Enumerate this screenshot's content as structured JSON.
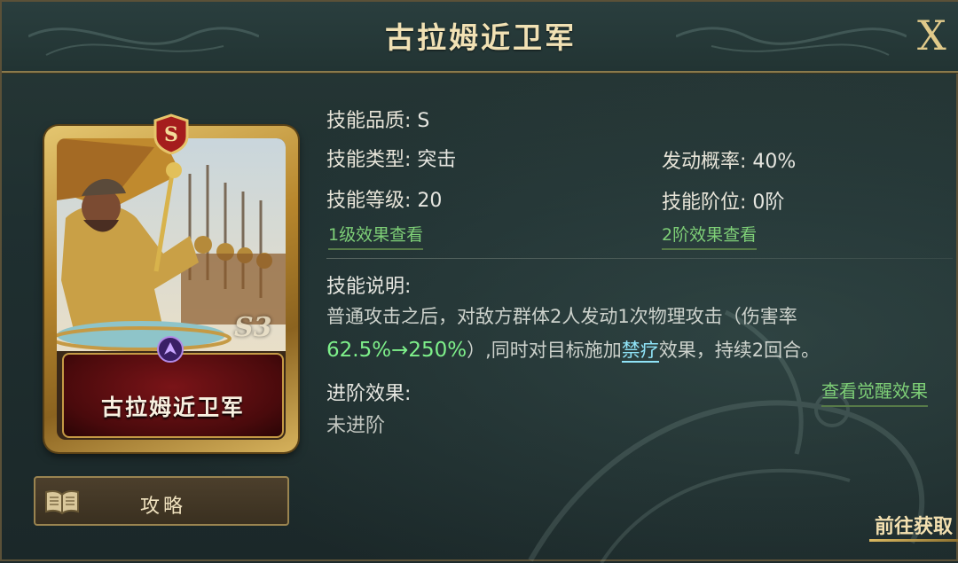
{
  "header": {
    "title": "古拉姆近卫军",
    "close_label": "X"
  },
  "card": {
    "name": "古拉姆近卫军",
    "grade_badge": "S",
    "season_mark": "S3"
  },
  "guide_button": {
    "label": "攻略"
  },
  "stats": {
    "quality_label": "技能品质:",
    "quality_value": "S",
    "type_label": "技能类型:",
    "type_value": "突击",
    "chance_label": "发动概率:",
    "chance_value": "40%",
    "level_label": "技能等级:",
    "level_value": "20",
    "tier_label": "技能阶位:",
    "tier_value": "0阶"
  },
  "links": {
    "level1_effects": "1级效果查看",
    "tier2_effects": "2阶效果查看",
    "awaken_effects": "查看觉醒效果"
  },
  "description": {
    "label": "技能说明:",
    "text_part1": "普通攻击之后，对敌方群体2人发动1次物理攻击（伤害率",
    "damage_rate": "62.5%→250%",
    "text_part2": "）,同时对目标施加",
    "keyword": "禁疗",
    "text_part3": "效果，持续2回合。"
  },
  "advancement": {
    "label": "进阶效果:",
    "value": "未进阶"
  },
  "go_button": {
    "label": "前往获取"
  },
  "colors": {
    "accent_gold": "#e0c98a",
    "link_green": "#7ecf77",
    "damage_green": "#7ef08a",
    "keyword_cyan": "#8fe3f7"
  }
}
